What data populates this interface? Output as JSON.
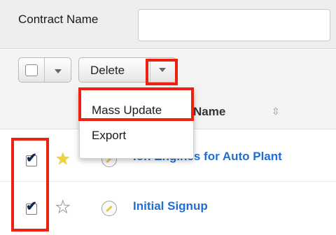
{
  "filter": {
    "contract_label": "Contract Name",
    "contract_value": ""
  },
  "toolbar": {
    "delete_label": "Delete"
  },
  "list": {
    "name_column": "Name",
    "rows": [
      {
        "name": "Ion Engines for Auto Plant",
        "selected": true,
        "favorite": true
      },
      {
        "name": "Initial Signup",
        "selected": true,
        "favorite": false
      }
    ]
  },
  "dropdown": {
    "items": [
      "Mass Update",
      "Export"
    ]
  },
  "icons": {
    "check": "✔",
    "star": "★",
    "sort": "⇳"
  },
  "colors": {
    "highlight": "#f0200f",
    "link": "#1f6ed4",
    "favorite_star": "#f0d23a"
  }
}
